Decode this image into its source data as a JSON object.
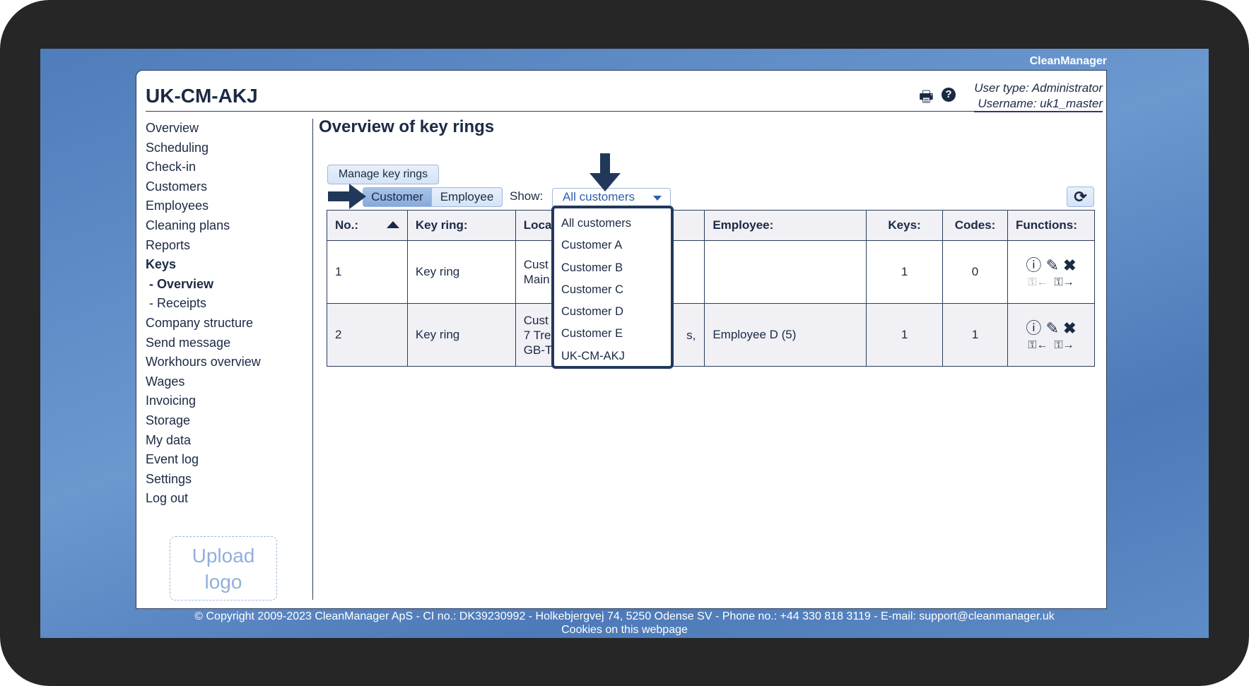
{
  "app": {
    "brand": "CleanManager",
    "title": "UK-CM-AKJ"
  },
  "header": {
    "user_type": "User type: Administrator",
    "username": "Username: uk1_master",
    "icons": [
      "print-icon",
      "help-icon"
    ]
  },
  "sidebar": {
    "items": [
      {
        "label": "Overview"
      },
      {
        "label": "Scheduling"
      },
      {
        "label": "Check-in"
      },
      {
        "label": "Customers"
      },
      {
        "label": "Employees"
      },
      {
        "label": "Cleaning plans"
      },
      {
        "label": "Reports"
      },
      {
        "label": "Keys",
        "bold": true
      },
      {
        "label": "- Overview",
        "bold": true
      },
      {
        "label": "- Receipts"
      },
      {
        "label": "Company structure"
      },
      {
        "label": "Send message"
      },
      {
        "label": "Workhours overview"
      },
      {
        "label": "Wages"
      },
      {
        "label": "Invoicing"
      },
      {
        "label": "Storage"
      },
      {
        "label": "My data"
      },
      {
        "label": "Event log"
      },
      {
        "label": "Settings"
      },
      {
        "label": "Log out"
      }
    ],
    "upload_line1": "Upload",
    "upload_line2": "logo"
  },
  "main": {
    "title": "Overview of key rings",
    "manage_button": "Manage key rings",
    "tabs": [
      {
        "label": "Customer",
        "active": true
      },
      {
        "label": "Employee"
      }
    ],
    "show_label": "Show:",
    "show_value": "All customers",
    "dropdown_options": [
      "All customers",
      "Customer A",
      "Customer B",
      "Customer C",
      "Customer D",
      "Customer E",
      "UK-CM-AKJ"
    ],
    "table": {
      "headers": [
        "No.:",
        "Key ring:",
        "Loca",
        "",
        "Employee:",
        "Keys:",
        "Codes:",
        "Functions:"
      ],
      "rows": [
        {
          "no": "1",
          "key_ring": "Key ring",
          "location_1": "Cust",
          "location_2": "Main",
          "location_3": "",
          "employee": "",
          "keys": "1",
          "codes": "0",
          "key_in_enabled": false
        },
        {
          "no": "2",
          "key_ring": "Key ring",
          "location_1": "Cust",
          "location_2": "7 Tre",
          "location_3": "GB-T",
          "extra": "s,",
          "employee": "Employee D (5)",
          "keys": "1",
          "codes": "1",
          "key_in_enabled": true
        }
      ]
    }
  },
  "footer": {
    "copyright": "© Copyright 2009-2023 CleanManager ApS - CI no.: DK39230992 - Holkebjergvej 74, 5250 Odense SV - Phone no.: +44 330 818 3119 - E-mail: support@cleanmanager.uk",
    "cookies": "Cookies on this webpage"
  },
  "colors": {
    "accent": "#2e5fa8",
    "dark": "#22385b",
    "background": "#5e8cc6"
  }
}
